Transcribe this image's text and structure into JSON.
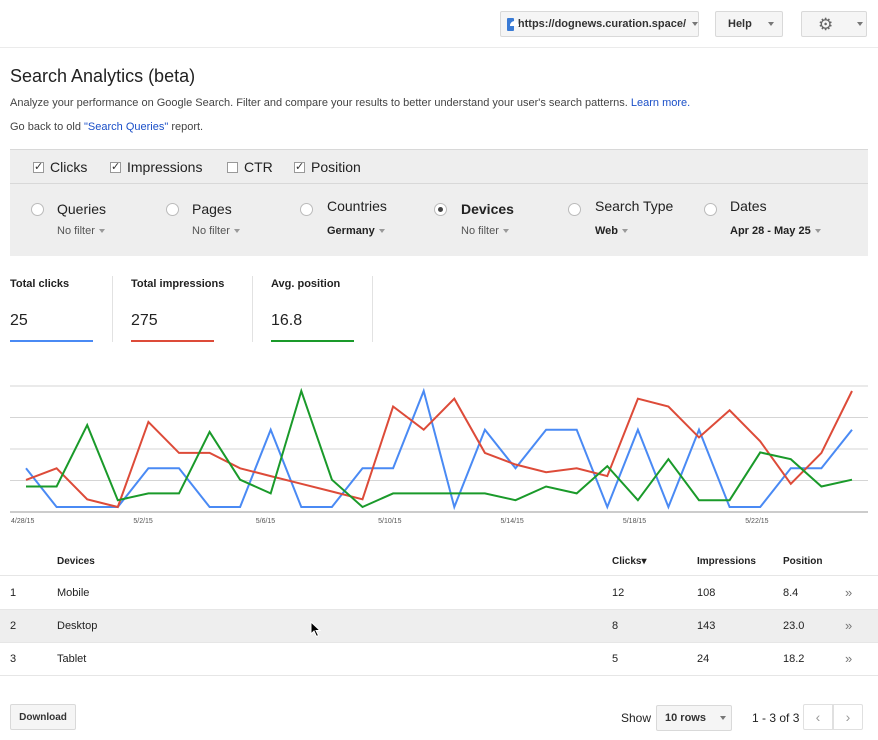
{
  "header": {
    "site_url": "https://dognews.curation.space/",
    "help_label": "Help",
    "settings_icon": "gear-icon"
  },
  "page": {
    "title": "Search Analytics (beta)",
    "description": "Analyze your performance on Google Search. Filter and compare your results to better understand your user's search patterns.",
    "learn_more": "Learn more.",
    "back_prefix": "Go back to old",
    "back_link": "\"Search Queries\"",
    "back_suffix": "report."
  },
  "metrics": [
    {
      "label": "Clicks",
      "checked": true
    },
    {
      "label": "Impressions",
      "checked": true
    },
    {
      "label": "CTR",
      "checked": false
    },
    {
      "label": "Position",
      "checked": true
    }
  ],
  "dimensions": [
    {
      "label": "Queries",
      "filter": "No filter",
      "selected": false
    },
    {
      "label": "Pages",
      "filter": "No filter",
      "selected": false
    },
    {
      "label": "Countries",
      "filter": "Germany",
      "selected": false
    },
    {
      "label": "Devices",
      "filter": "No filter",
      "selected": true
    },
    {
      "label": "Search Type",
      "filter": "Web",
      "selected": false
    },
    {
      "label": "Dates",
      "filter": "Apr 28 - May 25",
      "selected": false
    }
  ],
  "totals": [
    {
      "label": "Total clicks",
      "value": "25",
      "color": "#4a8af4"
    },
    {
      "label": "Total impressions",
      "value": "275",
      "color": "#dd4b39"
    },
    {
      "label": "Avg. position",
      "value": "16.8",
      "color": "#1a9a2a"
    }
  ],
  "chart_data": {
    "type": "line",
    "x": [
      "4/28/15",
      "4/29/15",
      "4/30/15",
      "5/1/15",
      "5/2/15",
      "5/3/15",
      "5/4/15",
      "5/5/15",
      "5/6/15",
      "5/7/15",
      "5/8/15",
      "5/9/15",
      "5/10/15",
      "5/11/15",
      "5/12/15",
      "5/13/15",
      "5/14/15",
      "5/15/15",
      "5/16/15",
      "5/17/15",
      "5/18/15",
      "5/19/15",
      "5/20/15",
      "5/21/15",
      "5/22/15",
      "5/23/15",
      "5/24/15",
      "5/25/15"
    ],
    "x_tick_labels": [
      "4/28/15",
      "5/2/15",
      "5/6/15",
      "5/10/15",
      "5/14/15",
      "5/18/15",
      "5/22/15"
    ],
    "grid": true,
    "series": [
      {
        "color": "#4a8af4",
        "values": [
          1,
          0,
          0,
          0,
          1,
          1,
          0,
          0,
          2,
          0,
          0,
          1,
          1,
          3,
          0,
          2,
          1,
          2,
          2,
          0,
          2,
          0,
          2,
          0,
          0,
          1,
          1,
          2
        ]
      },
      {
        "color": "#dd4b39",
        "values": [
          13,
          16,
          8,
          6,
          28,
          20,
          20,
          16,
          14,
          12,
          10,
          8,
          32,
          26,
          34,
          20,
          17,
          15,
          16,
          14,
          34,
          32,
          24,
          31,
          23,
          12,
          20,
          36
        ]
      },
      {
        "color": "#1a9a2a",
        "values": [
          10,
          10,
          19,
          8,
          9,
          9,
          18,
          11,
          9,
          24,
          11,
          7,
          9,
          9,
          9,
          9,
          8,
          10,
          9,
          13,
          8,
          14,
          8,
          8,
          15,
          14,
          10,
          11
        ]
      }
    ]
  },
  "table": {
    "columns": [
      "Devices",
      "Clicks▾",
      "Impressions",
      "Position"
    ],
    "rows": [
      {
        "index": "1",
        "device": "Mobile",
        "clicks": "12",
        "impressions": "108",
        "position": "8.4"
      },
      {
        "index": "2",
        "device": "Desktop",
        "clicks": "8",
        "impressions": "143",
        "position": "23.0"
      },
      {
        "index": "3",
        "device": "Tablet",
        "clicks": "5",
        "impressions": "24",
        "position": "18.2"
      }
    ],
    "row_action": "»"
  },
  "footer": {
    "download_label": "Download",
    "show_label": "Show",
    "rows_option": "10 rows",
    "range": "1 - 3 of 3",
    "prev": "‹",
    "next": "›"
  }
}
